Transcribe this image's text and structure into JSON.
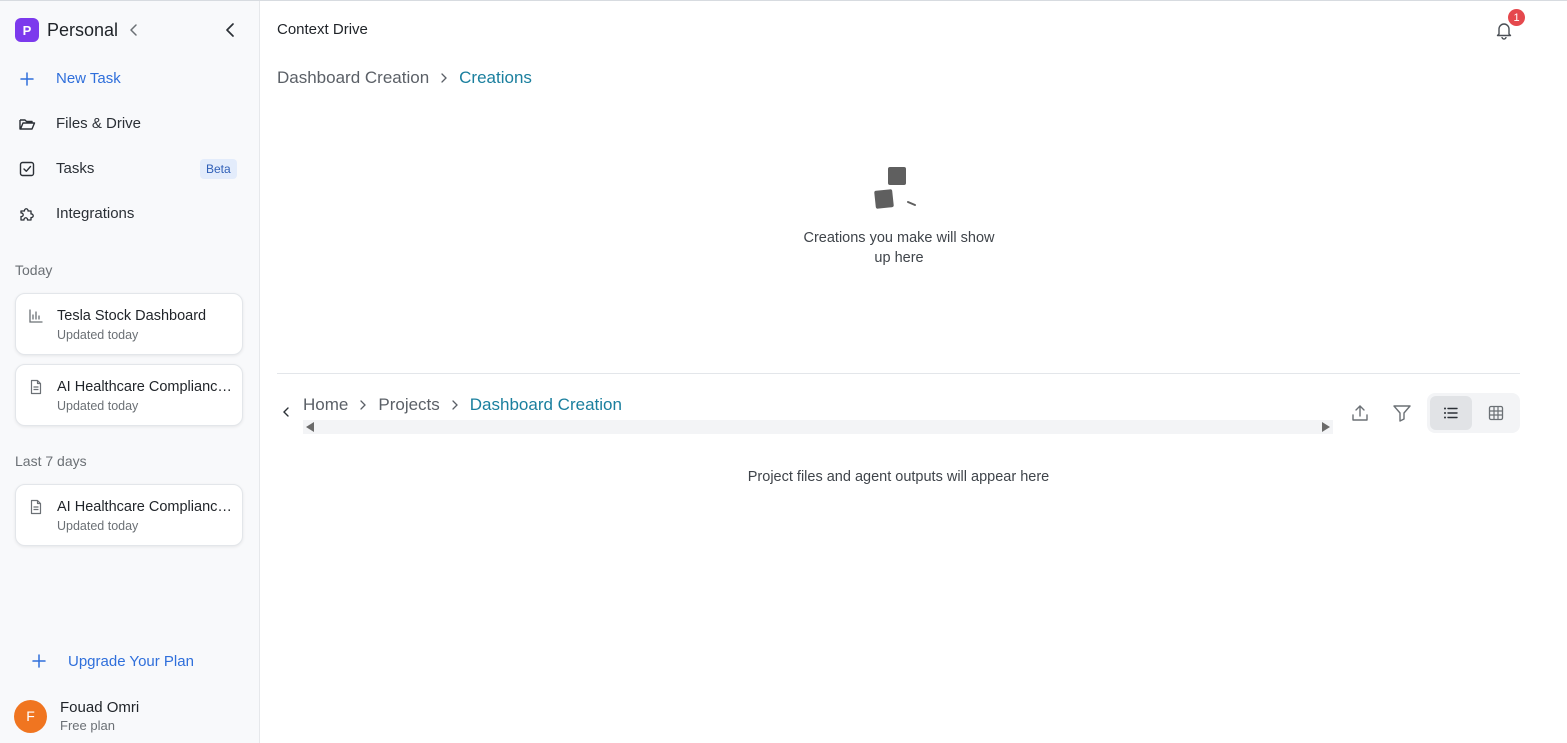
{
  "workspace": {
    "initial": "P",
    "name": "Personal"
  },
  "nav": {
    "new_task": "New Task",
    "files_drive": "Files & Drive",
    "tasks": "Tasks",
    "tasks_badge": "Beta",
    "integrations": "Integrations"
  },
  "sections": {
    "today": "Today",
    "last7": "Last 7 days"
  },
  "today_items": [
    {
      "title": "Tesla Stock Dashboard",
      "subtitle": "Updated today",
      "icon": "bar-chart-icon"
    },
    {
      "title": "AI Healthcare Compliance Report",
      "subtitle": "Updated today",
      "icon": "document-icon"
    }
  ],
  "last7_items": [
    {
      "title": "AI Healthcare Compliance Report",
      "subtitle": "Updated today",
      "icon": "document-icon"
    }
  ],
  "upgrade": "Upgrade Your Plan",
  "user": {
    "initial": "F",
    "name": "Fouad Omri",
    "plan": "Free plan"
  },
  "header": {
    "title": "Context Drive",
    "notification_count": "1"
  },
  "creations": {
    "breadcrumb": [
      "Dashboard Creation",
      "Creations"
    ],
    "empty_text": "Creations you make will show up here"
  },
  "files": {
    "breadcrumb": [
      "Home",
      "Projects",
      "Dashboard Creation"
    ],
    "empty_text": "Project files and agent outputs will appear here"
  },
  "colors": {
    "workspace": "#7c3aed",
    "accent_blue": "#2f6fdb",
    "breadcrumb_current": "#1a7f9e",
    "avatar": "#f07520",
    "notification": "#e5484d"
  }
}
